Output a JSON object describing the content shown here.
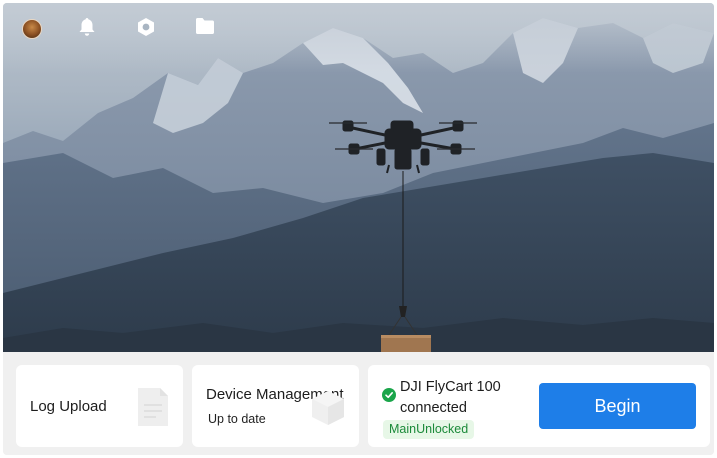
{
  "topbar": {
    "icons": [
      "avatar",
      "bell-icon",
      "settings-hex-icon",
      "folder-icon"
    ]
  },
  "cards": {
    "log_upload": {
      "title": "Log Upload"
    },
    "device_management": {
      "title": "Device Management",
      "subtitle": "Up to date"
    },
    "connection": {
      "status_text": "DJI FlyCart 100 connected",
      "badge": "MainUnlocked",
      "begin_label": "Begin"
    }
  },
  "colors": {
    "accent": "#1e7ee8",
    "success": "#1aa54a",
    "badge_bg": "#e7f7e7",
    "badge_text": "#1c8a3a"
  }
}
